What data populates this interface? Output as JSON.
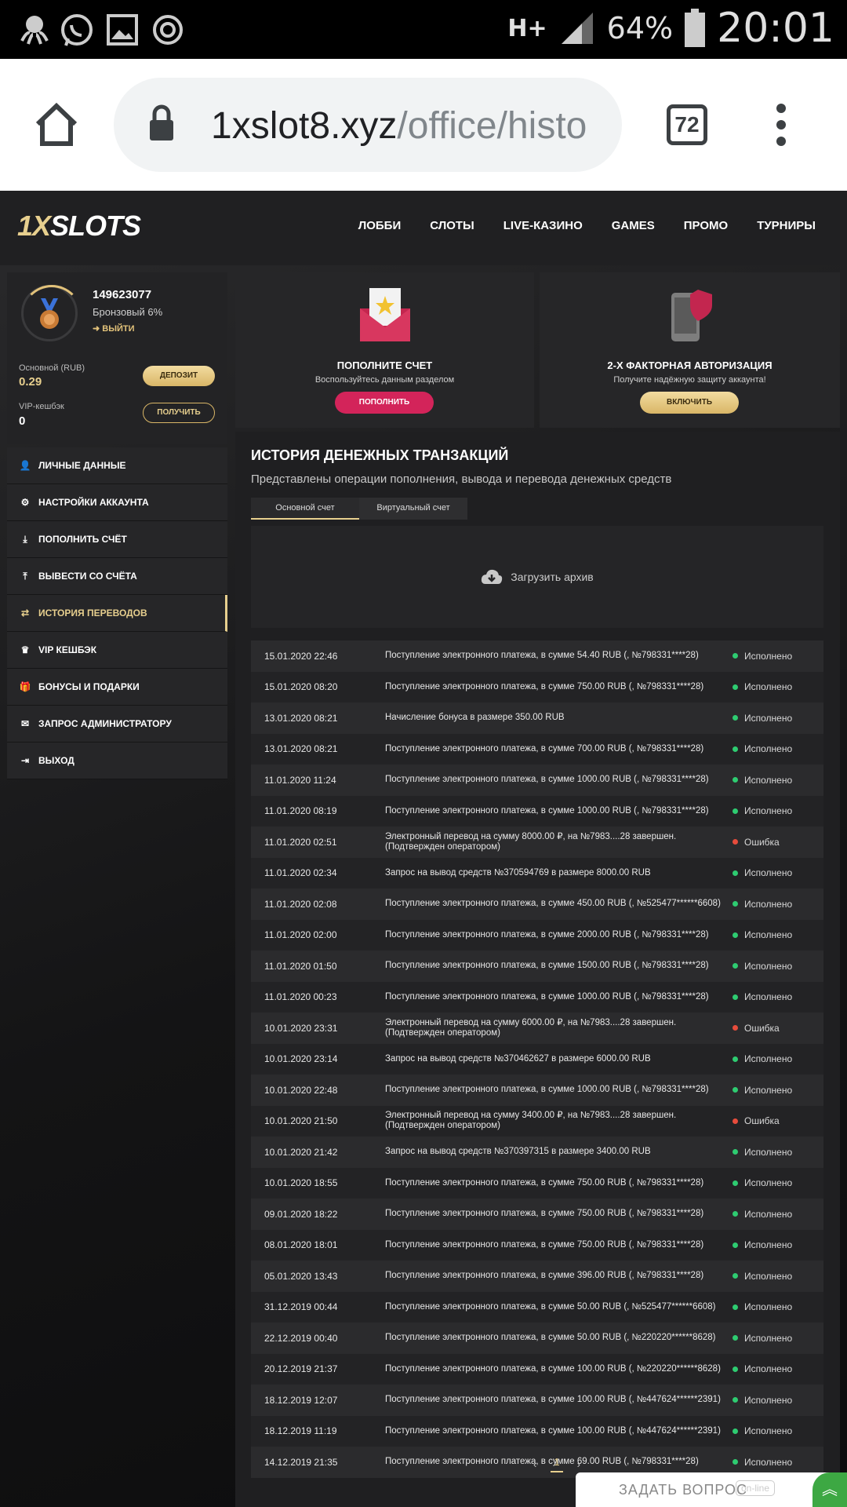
{
  "statusbar": {
    "network": "H+",
    "battery_pct": "64%",
    "time": "20:01"
  },
  "browser": {
    "url_host": "1xslot8.xyz",
    "url_path": "/office/histo",
    "tab_count": "72"
  },
  "site": {
    "logo_gold": "1X",
    "logo_white": "SLOTS",
    "nav": [
      "ЛОББИ",
      "СЛОТЫ",
      "LIVE-КАЗИНО",
      "GAMES",
      "ПРОМО",
      "ТУРНИРЫ"
    ]
  },
  "profile": {
    "user_id": "149623077",
    "rank": "Бронзовый 6%",
    "logout": "ВЫЙТИ",
    "main_label": "Основной (RUB)",
    "main_value": "0.29",
    "deposit_btn": "ДЕПОЗИТ",
    "vip_label": "VIP-кешбэк",
    "vip_value": "0",
    "receive_btn": "ПОЛУЧИТЬ"
  },
  "sidemenu": [
    {
      "icon": "user-add-icon",
      "label": "ЛИЧНЫЕ ДАННЫЕ"
    },
    {
      "icon": "settings-icon",
      "label": "НАСТРОЙКИ АККАУНТА"
    },
    {
      "icon": "download-icon",
      "label": "ПОПОЛНИТЬ СЧЁТ"
    },
    {
      "icon": "upload-icon",
      "label": "ВЫВЕСТИ СО СЧЁТА"
    },
    {
      "icon": "transfer-icon",
      "label": "ИСТОРИЯ ПЕРЕВОДОВ"
    },
    {
      "icon": "crown-icon",
      "label": "VIP КЕШБЭК"
    },
    {
      "icon": "gift-icon",
      "label": "БОНУСЫ И ПОДАРКИ"
    },
    {
      "icon": "mail-icon",
      "label": "ЗАПРОС АДМИНИСТРАТОРУ"
    },
    {
      "icon": "logout-icon",
      "label": "ВЫХОД"
    }
  ],
  "cards": {
    "deposit": {
      "title": "ПОПОЛНИТЕ СЧЕТ",
      "subtitle": "Воспользуйтесь данным разделом",
      "button": "ПОПОЛНИТЬ"
    },
    "twofa": {
      "title": "2-Х ФАКТОРНАЯ АВТОРИЗАЦИЯ",
      "subtitle": "Получите надёжную защиту аккаунта!",
      "button": "ВКЛЮЧИТЬ"
    }
  },
  "history": {
    "title": "ИСТОРИЯ ДЕНЕЖНЫХ ТРАНЗАКЦИЙ",
    "subtitle": "Представлены операции пополнения, вывода и перевода денежных средств",
    "tabs": [
      "Основной счет",
      "Виртуальный счет"
    ],
    "archive": "Загрузить архив",
    "rows": [
      {
        "date": "15.01.2020 22:46",
        "desc": "Поступление электронного платежа, в сумме 54.40 RUB (, №798331****28)",
        "status": "Исполнено",
        "ok": true
      },
      {
        "date": "15.01.2020 08:20",
        "desc": "Поступление электронного платежа, в сумме 750.00 RUB (, №798331****28)",
        "status": "Исполнено",
        "ok": true
      },
      {
        "date": "13.01.2020 08:21",
        "desc": "Начисление бонуса в размере 350.00 RUB",
        "status": "Исполнено",
        "ok": true
      },
      {
        "date": "13.01.2020 08:21",
        "desc": "Поступление электронного платежа, в сумме 700.00 RUB (, №798331****28)",
        "status": "Исполнено",
        "ok": true
      },
      {
        "date": "11.01.2020 11:24",
        "desc": "Поступление электронного платежа, в сумме 1000.00 RUB (, №798331****28)",
        "status": "Исполнено",
        "ok": true
      },
      {
        "date": "11.01.2020 08:19",
        "desc": "Поступление электронного платежа, в сумме 1000.00 RUB (, №798331****28)",
        "status": "Исполнено",
        "ok": true
      },
      {
        "date": "11.01.2020 02:51",
        "desc": "Электронный перевод на сумму 8000.00 ₽, на №7983....28 завершен. (Подтвержден оператором)",
        "status": "Ошибка",
        "ok": false
      },
      {
        "date": "11.01.2020 02:34",
        "desc": "Запрос на вывод средств №370594769 в размере 8000.00 RUB",
        "status": "Исполнено",
        "ok": true
      },
      {
        "date": "11.01.2020 02:08",
        "desc": "Поступление электронного платежа, в сумме 450.00 RUB (, №525477******6608)",
        "status": "Исполнено",
        "ok": true
      },
      {
        "date": "11.01.2020 02:00",
        "desc": "Поступление электронного платежа, в сумме 2000.00 RUB (, №798331****28)",
        "status": "Исполнено",
        "ok": true
      },
      {
        "date": "11.01.2020 01:50",
        "desc": "Поступление электронного платежа, в сумме 1500.00 RUB (, №798331****28)",
        "status": "Исполнено",
        "ok": true
      },
      {
        "date": "11.01.2020 00:23",
        "desc": "Поступление электронного платежа, в сумме 1000.00 RUB (, №798331****28)",
        "status": "Исполнено",
        "ok": true
      },
      {
        "date": "10.01.2020 23:31",
        "desc": "Электронный перевод на сумму 6000.00 ₽, на №7983....28 завершен. (Подтвержден оператором)",
        "status": "Ошибка",
        "ok": false
      },
      {
        "date": "10.01.2020 23:14",
        "desc": "Запрос на вывод средств №370462627 в размере 6000.00 RUB",
        "status": "Исполнено",
        "ok": true
      },
      {
        "date": "10.01.2020 22:48",
        "desc": "Поступление электронного платежа, в сумме 1000.00 RUB (, №798331****28)",
        "status": "Исполнено",
        "ok": true
      },
      {
        "date": "10.01.2020 21:50",
        "desc": "Электронный перевод на сумму 3400.00 ₽, на №7983....28 завершен. (Подтвержден оператором)",
        "status": "Ошибка",
        "ok": false
      },
      {
        "date": "10.01.2020 21:42",
        "desc": "Запрос на вывод средств №370397315 в размере 3400.00 RUB",
        "status": "Исполнено",
        "ok": true
      },
      {
        "date": "10.01.2020 18:55",
        "desc": "Поступление электронного платежа, в сумме 750.00 RUB (, №798331****28)",
        "status": "Исполнено",
        "ok": true
      },
      {
        "date": "09.01.2020 18:22",
        "desc": "Поступление электронного платежа, в сумме 750.00 RUB (, №798331****28)",
        "status": "Исполнено",
        "ok": true
      },
      {
        "date": "08.01.2020 18:01",
        "desc": "Поступление электронного платежа, в сумме 750.00 RUB (, №798331****28)",
        "status": "Исполнено",
        "ok": true
      },
      {
        "date": "05.01.2020 13:43",
        "desc": "Поступление электронного платежа, в сумме 396.00 RUB (, №798331****28)",
        "status": "Исполнено",
        "ok": true
      },
      {
        "date": "31.12.2019 00:44",
        "desc": "Поступление электронного платежа, в сумме 50.00 RUB (, №525477******6608)",
        "status": "Исполнено",
        "ok": true
      },
      {
        "date": "22.12.2019 00:40",
        "desc": "Поступление электронного платежа, в сумме 50.00 RUB (, №220220******8628)",
        "status": "Исполнено",
        "ok": true
      },
      {
        "date": "20.12.2019 21:37",
        "desc": "Поступление электронного платежа, в сумме 100.00 RUB (, №220220******8628)",
        "status": "Исполнено",
        "ok": true
      },
      {
        "date": "18.12.2019 12:07",
        "desc": "Поступление электронного платежа, в сумме 100.00 RUB (, №447624******2391)",
        "status": "Исполнено",
        "ok": true
      },
      {
        "date": "18.12.2019 11:19",
        "desc": "Поступление электронного платежа, в сумме 100.00 RUB (, №447624******2391)",
        "status": "Исполнено",
        "ok": true
      },
      {
        "date": "14.12.2019 21:35",
        "desc": "Поступление электронного платежа, в сумме 69.00 RUB (, №798331****28)",
        "status": "Исполнено",
        "ok": true
      }
    ],
    "pager": {
      "prev": "‹",
      "current": "1",
      "next": "›"
    }
  },
  "chat": {
    "label": "ЗАДАТЬ ВОПРОС",
    "status": "on-line"
  },
  "colors": {
    "accent_gold": "#e7cf8e",
    "ok_green": "#2ecc71",
    "error_red": "#e74c3c",
    "pink_btn": "#d3245a"
  }
}
